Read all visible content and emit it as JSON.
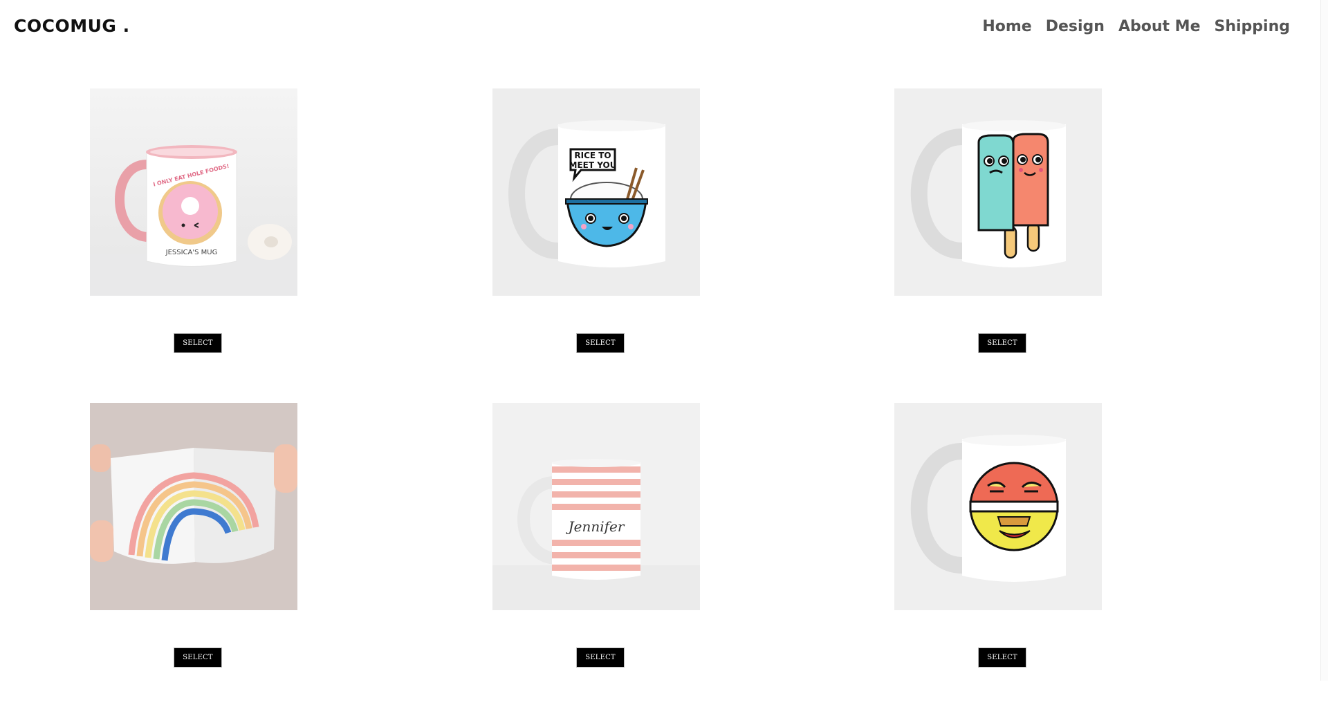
{
  "brand": {
    "logo": "COCOMUG ."
  },
  "nav": {
    "items": [
      "Home",
      "Design",
      "About Me",
      "Shipping"
    ]
  },
  "products": [
    {
      "design": "donut",
      "mug_text_top": "I ONLY EAT HOLE FOODS!",
      "mug_text_bottom": "JESSICA'S MUG",
      "button": "SELECT"
    },
    {
      "design": "rice-bowl",
      "mug_text_line1": "RICE TO",
      "mug_text_line2": "MEET YOU",
      "button": "SELECT"
    },
    {
      "design": "popsicles",
      "button": "SELECT"
    },
    {
      "design": "rainbow",
      "button": "SELECT"
    },
    {
      "design": "stripes",
      "mug_text": "Jennifer",
      "button": "SELECT"
    },
    {
      "design": "face-ball",
      "button": "SELECT"
    }
  ],
  "colors": {
    "button_bg": "#000000",
    "button_text": "#ffffff",
    "nav_text": "#555555"
  }
}
